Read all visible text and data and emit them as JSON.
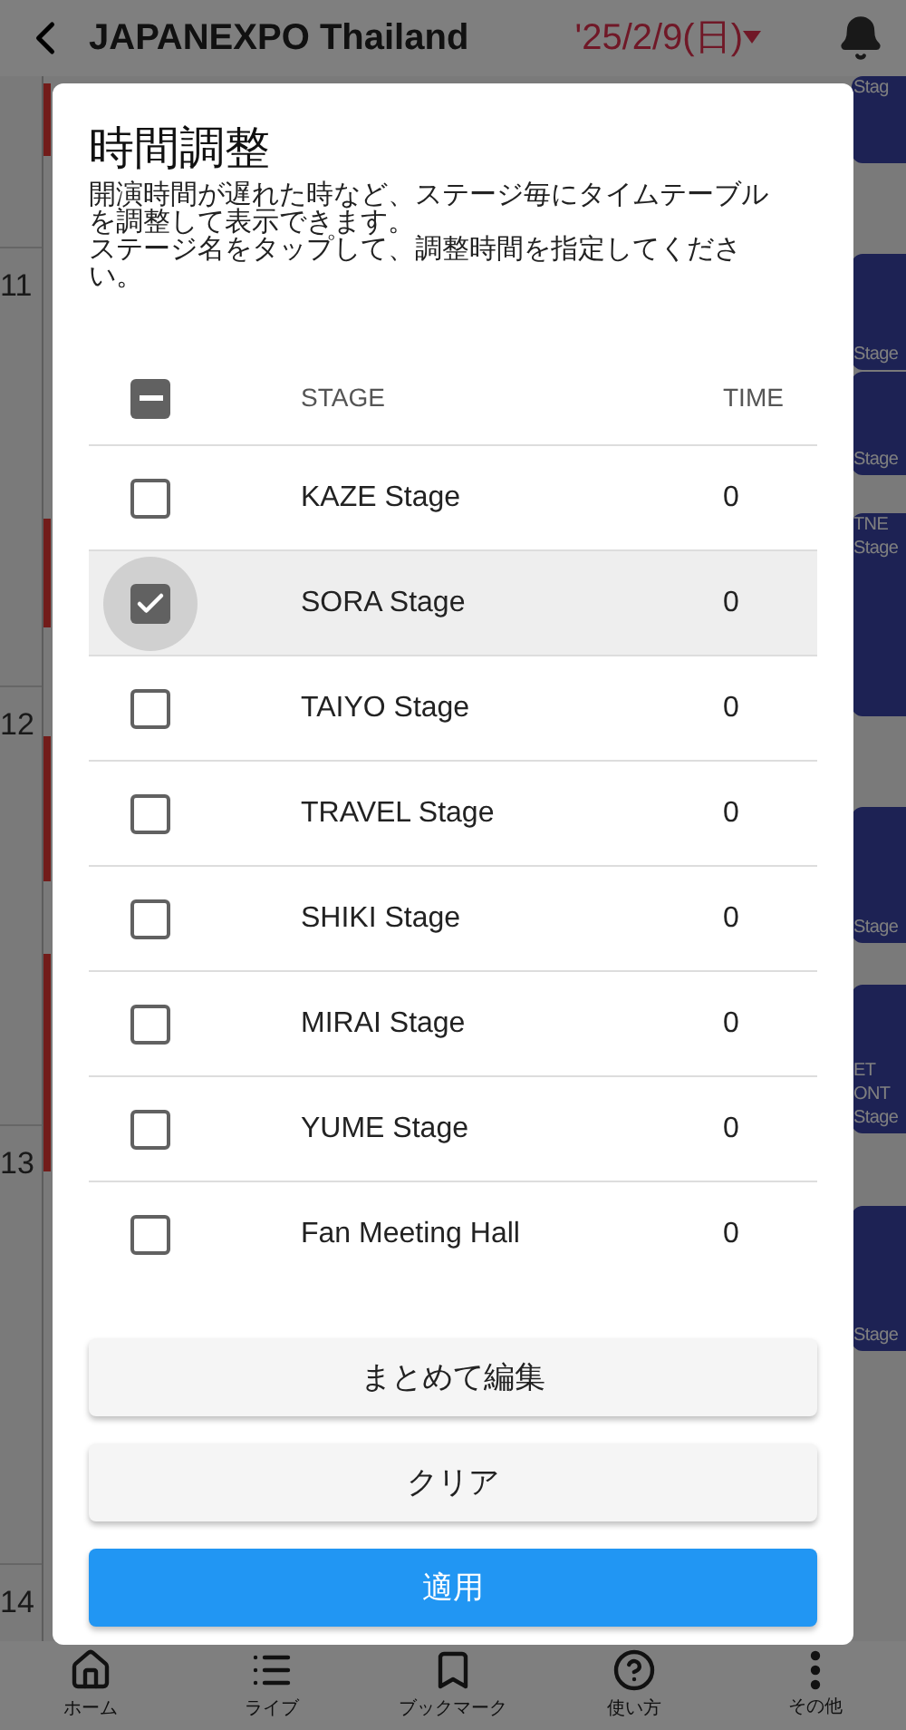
{
  "app_bar": {
    "title": "JAPANEXPO Thailand",
    "date": "'25/2/9(日)"
  },
  "timetable": {
    "hours": [
      "11",
      "12",
      "13",
      "14"
    ],
    "blocks": [
      {
        "lines": [
          "Stag"
        ]
      },
      {
        "lines": [
          "Stage"
        ]
      },
      {
        "lines": [
          "Stage"
        ]
      },
      {
        "lines": [
          "TNE",
          "Stage"
        ]
      },
      {
        "lines": [
          "Stage"
        ]
      },
      {
        "lines": [
          "ET",
          "ONT",
          "Stage"
        ]
      },
      {
        "lines": [
          "Stage"
        ]
      }
    ]
  },
  "dialog": {
    "title": "時間調整",
    "description": [
      "開演時間が遅れた時など、ステージ毎にタイムテーブルを調整して表示できます。",
      "ステージ名をタップして、調整時間を指定してください。"
    ],
    "table": {
      "header_indeterminate": true,
      "columns": [
        "STAGE",
        "TIME"
      ],
      "rows": [
        {
          "stage": "KAZE Stage",
          "time": "0",
          "checked": false
        },
        {
          "stage": "SORA Stage",
          "time": "0",
          "checked": true
        },
        {
          "stage": "TAIYO Stage",
          "time": "0",
          "checked": false
        },
        {
          "stage": "TRAVEL Stage",
          "time": "0",
          "checked": false
        },
        {
          "stage": "SHIKI Stage",
          "time": "0",
          "checked": false
        },
        {
          "stage": "MIRAI Stage",
          "time": "0",
          "checked": false
        },
        {
          "stage": "YUME Stage",
          "time": "0",
          "checked": false
        },
        {
          "stage": "Fan Meeting Hall",
          "time": "0",
          "checked": false
        }
      ]
    },
    "buttons": [
      {
        "label": "まとめて編集",
        "kind": "secondary"
      },
      {
        "label": "クリア",
        "kind": "secondary"
      },
      {
        "label": "適用",
        "kind": "primary"
      }
    ]
  },
  "bottom_nav": [
    {
      "label": "ホーム"
    },
    {
      "label": "ライブ"
    },
    {
      "label": "ブックマーク"
    },
    {
      "label": "使い方"
    },
    {
      "label": "その他"
    }
  ]
}
